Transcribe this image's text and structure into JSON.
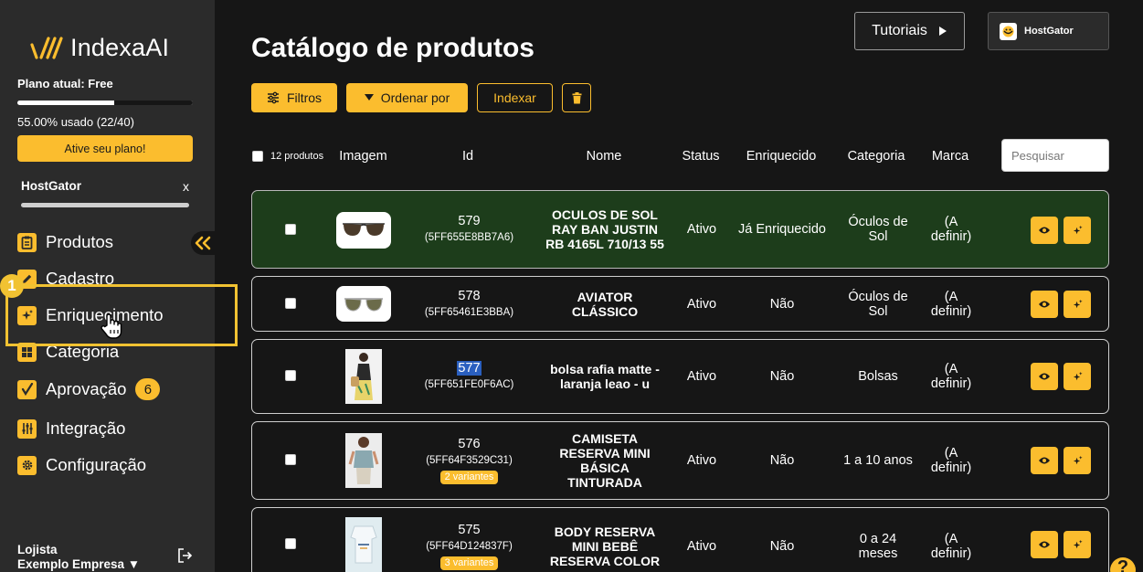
{
  "sidebar": {
    "logo_text": "IndexaAI",
    "plan_label": "Plano atual: Free",
    "plan_usage": "55.00% usado (22/40)",
    "plan_usage_fraction": 0.55,
    "activate_label": "Ative seu plano!",
    "store_name": "HostGator",
    "store_close": "x",
    "nav": [
      {
        "label": "Produtos",
        "icon": "clipboard-icon"
      },
      {
        "label": "Cadastro",
        "icon": "pencil-icon"
      },
      {
        "label": "Enriquecimento",
        "icon": "sparkle-icon"
      },
      {
        "label": "Categoria",
        "icon": "grid-icon"
      },
      {
        "label": "Aprovação",
        "icon": "check-icon",
        "badge": "6"
      },
      {
        "label": "Integração",
        "icon": "sliders-icon"
      },
      {
        "label": "Configuração",
        "icon": "gear-icon"
      }
    ],
    "step_badge": "1",
    "user_name": "Lojista",
    "user_company": "Exemplo Empresa ▼"
  },
  "header": {
    "title": "Catálogo de produtos",
    "tutorials_label": "Tutoriais",
    "account_name": "HostGator"
  },
  "toolbar": {
    "filters_label": "Filtros",
    "sort_label": "Ordenar por",
    "index_label": "Indexar"
  },
  "table": {
    "select_count": "12 produtos",
    "columns": [
      "Imagem",
      "Id",
      "Nome",
      "Status",
      "Enriquecido",
      "Categoria",
      "Marca"
    ],
    "search_placeholder": "Pesquisar",
    "rows": [
      {
        "id": "579",
        "sku": "(5FF655E8BB7A6)",
        "variants": "",
        "name": "OCULOS DE SOL RAY BAN JUSTIN RB 4165L 710/13 55",
        "status": "Ativo",
        "enriched": "Já Enriquecido",
        "category": "Óculos de Sol",
        "brand": "(A definir)",
        "image": "sunglasses"
      },
      {
        "id": "578",
        "sku": "(5FF65461E3BBA)",
        "variants": "",
        "name": "AVIATOR CLÁSSICO",
        "status": "Ativo",
        "enriched": "Não",
        "category": "Óculos de Sol",
        "brand": "(A definir)",
        "image": "aviator"
      },
      {
        "id": "577",
        "sku": "(5FF651FE0F6AC)",
        "variants": "",
        "name": "bolsa rafia matte - laranja leao - u",
        "status": "Ativo",
        "enriched": "Não",
        "category": "Bolsas",
        "brand": "(A definir)",
        "image": "bag"
      },
      {
        "id": "576",
        "sku": "(5FF64F3529C31)",
        "variants": "2 variantes",
        "name": "CAMISETA RESERVA MINI BÁSICA TINTURADA",
        "status": "Ativo",
        "enriched": "Não",
        "category": "1 a 10 anos",
        "brand": "(A definir)",
        "image": "kid"
      },
      {
        "id": "575",
        "sku": "(5FF64D124837F)",
        "variants": "3 variantes",
        "name": "BODY RESERVA MINI BEBÊ RESERVA COLOR",
        "status": "Ativo",
        "enriched": "Não",
        "category": "0 a 24 meses",
        "brand": "(A definir)",
        "image": "body"
      }
    ]
  },
  "help_label": "?",
  "colors": {
    "accent": "#fbbd2e",
    "sidebar": "#2b2b2b",
    "background": "#161616",
    "enriched_row": "#1d3d1b",
    "highlight": "#f1c232"
  }
}
